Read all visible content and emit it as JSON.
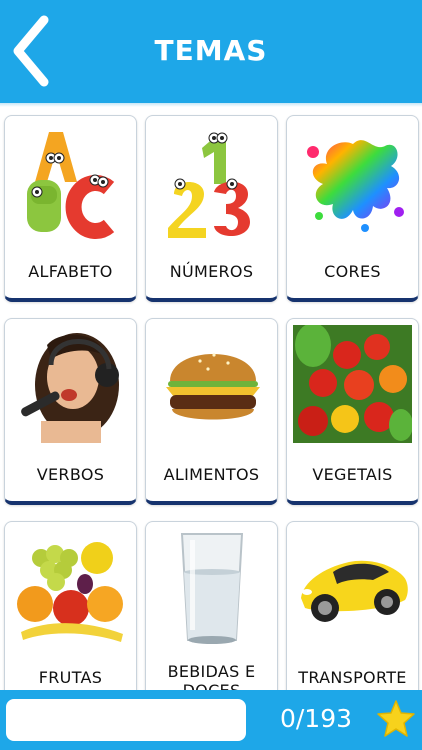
{
  "header": {
    "title": "TEMAS",
    "back_icon": "chevron-left-icon"
  },
  "topics": [
    {
      "label": "ALFABETO",
      "icon": "alphabet-blocks-image"
    },
    {
      "label": "NÚMEROS",
      "icon": "numbers-image"
    },
    {
      "label": "CORES",
      "icon": "color-splash-image"
    },
    {
      "label": "VERBOS",
      "icon": "singing-girl-image"
    },
    {
      "label": "ALIMENTOS",
      "icon": "burger-image"
    },
    {
      "label": "VEGETAIS",
      "icon": "vegetables-image"
    },
    {
      "label": "FRUTAS",
      "icon": "fruits-image"
    },
    {
      "label": "BEBIDAS E DOCES",
      "line1": "BEBIDAS E",
      "line2": "DOCES",
      "icon": "glass-of-water-image"
    },
    {
      "label": "TRANSPORTE",
      "icon": "car-image"
    }
  ],
  "footer": {
    "score": "0/193",
    "progress": 0,
    "star_icon": "star-icon"
  },
  "colors": {
    "header_bg": "#1ea7e8",
    "card_border": "#16336e",
    "star": "#f7d21c"
  }
}
